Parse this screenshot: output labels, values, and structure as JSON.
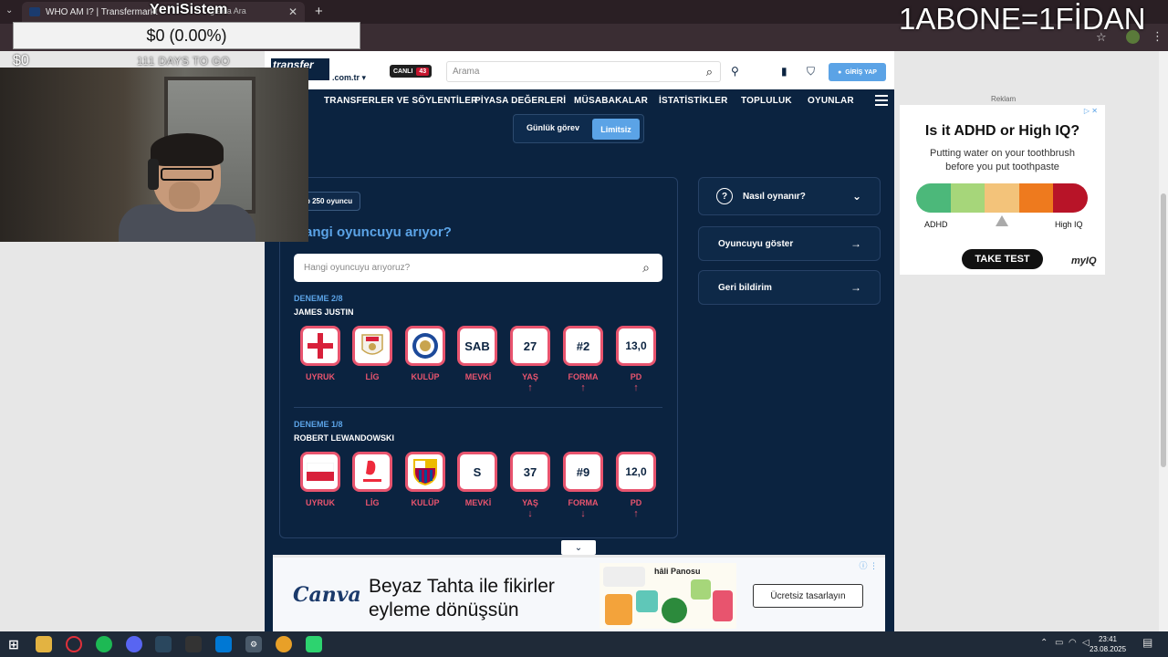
{
  "browser": {
    "tab_title": "WHO AM I? | Transfermarkt",
    "tab2_label": "gle'da Ara",
    "new_tab": "+"
  },
  "stream": {
    "title": "YeniSistem",
    "banner": "1ABONE=1FİDAN",
    "donation_amount": "$0 (0.00%)",
    "goal_current": "$0",
    "goal_days": "111 DAYS TO GO"
  },
  "site": {
    "logo": "transfer",
    "logo_line2": "rkt",
    "logo_suffix": ".com.tr ▾",
    "live_label": "CANLI",
    "live_count": "43",
    "search_placeholder": "Arama",
    "login_label": "GİRİŞ YAP",
    "nav": [
      "TRANSFERLER VE SÖYLENTİLER",
      "PİYASA DEĞERLERİ",
      "MÜSABAKALAR",
      "İSTATİSTİKLER",
      "TOPLULUK",
      "OYUNLAR"
    ]
  },
  "game": {
    "mode_daily": "Günlük görev",
    "mode_unlimited": "Limitsiz",
    "top_badge": "p 250 oyuncu",
    "question": "angi oyuncuyu arıyor?",
    "input_placeholder": "Hangi oyuncuyu arıyoruz?",
    "attempts": [
      {
        "label": "DENEME 2/8",
        "player": "JAMES JUSTIN",
        "tiles": [
          {
            "key": "UYRUK",
            "value": "",
            "icon": "england-flag-icon",
            "arrow": ""
          },
          {
            "key": "LİG",
            "value": "",
            "icon": "championship-logo-icon",
            "arrow": ""
          },
          {
            "key": "KULÜP",
            "value": "",
            "icon": "leicester-crest-icon",
            "arrow": ""
          },
          {
            "key": "MEVKİ",
            "value": "SAB",
            "icon": "",
            "arrow": ""
          },
          {
            "key": "YAŞ",
            "value": "27",
            "icon": "",
            "arrow": "↑"
          },
          {
            "key": "FORMA",
            "value": "#2",
            "icon": "",
            "arrow": "↑"
          },
          {
            "key": "PD",
            "value": "13,0",
            "icon": "",
            "arrow": "↑"
          }
        ]
      },
      {
        "label": "DENEME 1/8",
        "player": "ROBERT LEWANDOWSKI",
        "tiles": [
          {
            "key": "UYRUK",
            "value": "",
            "icon": "poland-flag-icon",
            "arrow": ""
          },
          {
            "key": "LİG",
            "value": "",
            "icon": "laliga-logo-icon",
            "arrow": ""
          },
          {
            "key": "KULÜP",
            "value": "",
            "icon": "barcelona-crest-icon",
            "arrow": ""
          },
          {
            "key": "MEVKİ",
            "value": "S",
            "icon": "",
            "arrow": ""
          },
          {
            "key": "YAŞ",
            "value": "37",
            "icon": "",
            "arrow": "↓"
          },
          {
            "key": "FORMA",
            "value": "#9",
            "icon": "",
            "arrow": "↓"
          },
          {
            "key": "PD",
            "value": "12,0",
            "icon": "",
            "arrow": "↑"
          }
        ]
      }
    ],
    "side": {
      "how_to": "Nasıl oynanır?",
      "show_player": "Oyuncuyu göster",
      "feedback": "Geri bildirim"
    }
  },
  "ads": {
    "label": "Reklam",
    "side_title": "Is it ADHD or High IQ?",
    "side_sub1": "Putting water on your toothbrush",
    "side_sub2": "before you put toothpaste",
    "scale_left": "ADHD",
    "scale_right": "High IQ",
    "cta": "TAKE TEST",
    "brand": "myIQ",
    "scale_colors": [
      "#4cb87a",
      "#a6d67a",
      "#f3c37a",
      "#ee7a1e",
      "#b81428"
    ],
    "bottom_brand": "Canva",
    "bottom_line1": "Beyaz Tahta ile fikirler",
    "bottom_line2": "eyleme dönüşsün",
    "bottom_img_title": "hâli Panosu",
    "bottom_cta": "Ücretsiz tasarlayın"
  },
  "taskbar": {
    "time": "23:41",
    "date": "23.08.2025"
  }
}
